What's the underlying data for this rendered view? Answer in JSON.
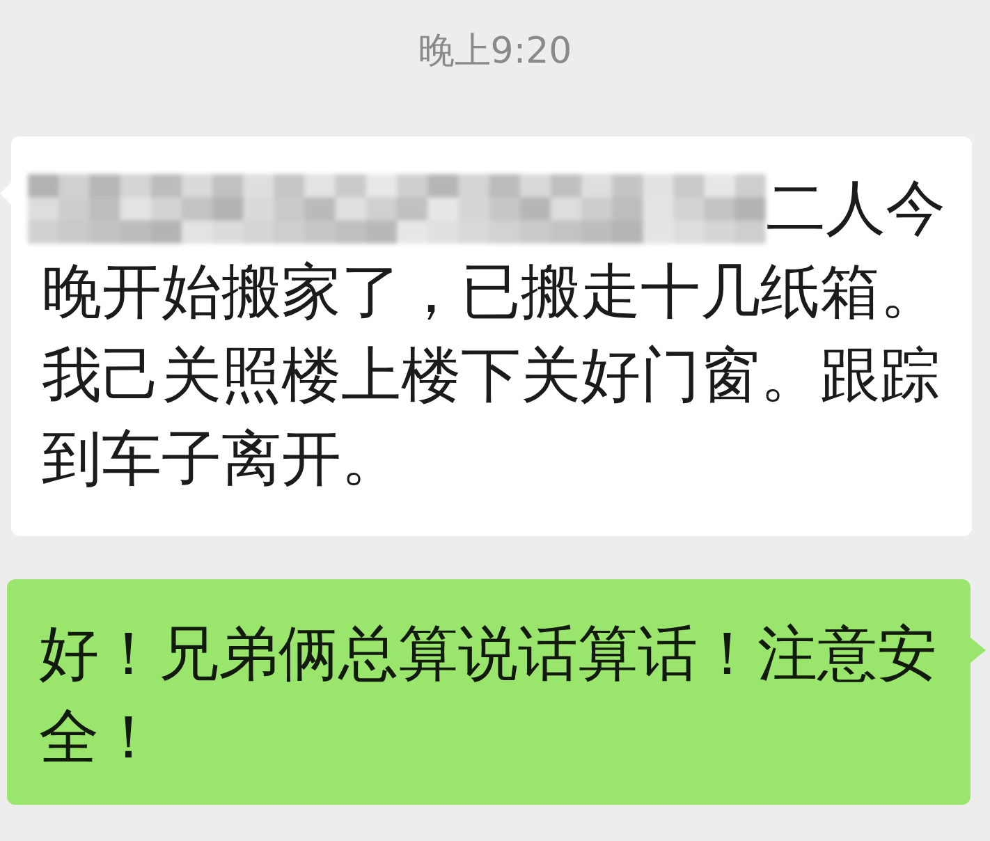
{
  "timestamp": "晚上9:20",
  "messages": [
    {
      "kind": "received",
      "redacted": true,
      "lead": "二人今",
      "text": "晚开始搬家了，已搬走十几纸箱。我己关照楼上楼下关好门窗。跟踪到车子离开。"
    },
    {
      "kind": "sent",
      "text": "好！兄弟俩总算说话算话！注意安全！"
    }
  ]
}
